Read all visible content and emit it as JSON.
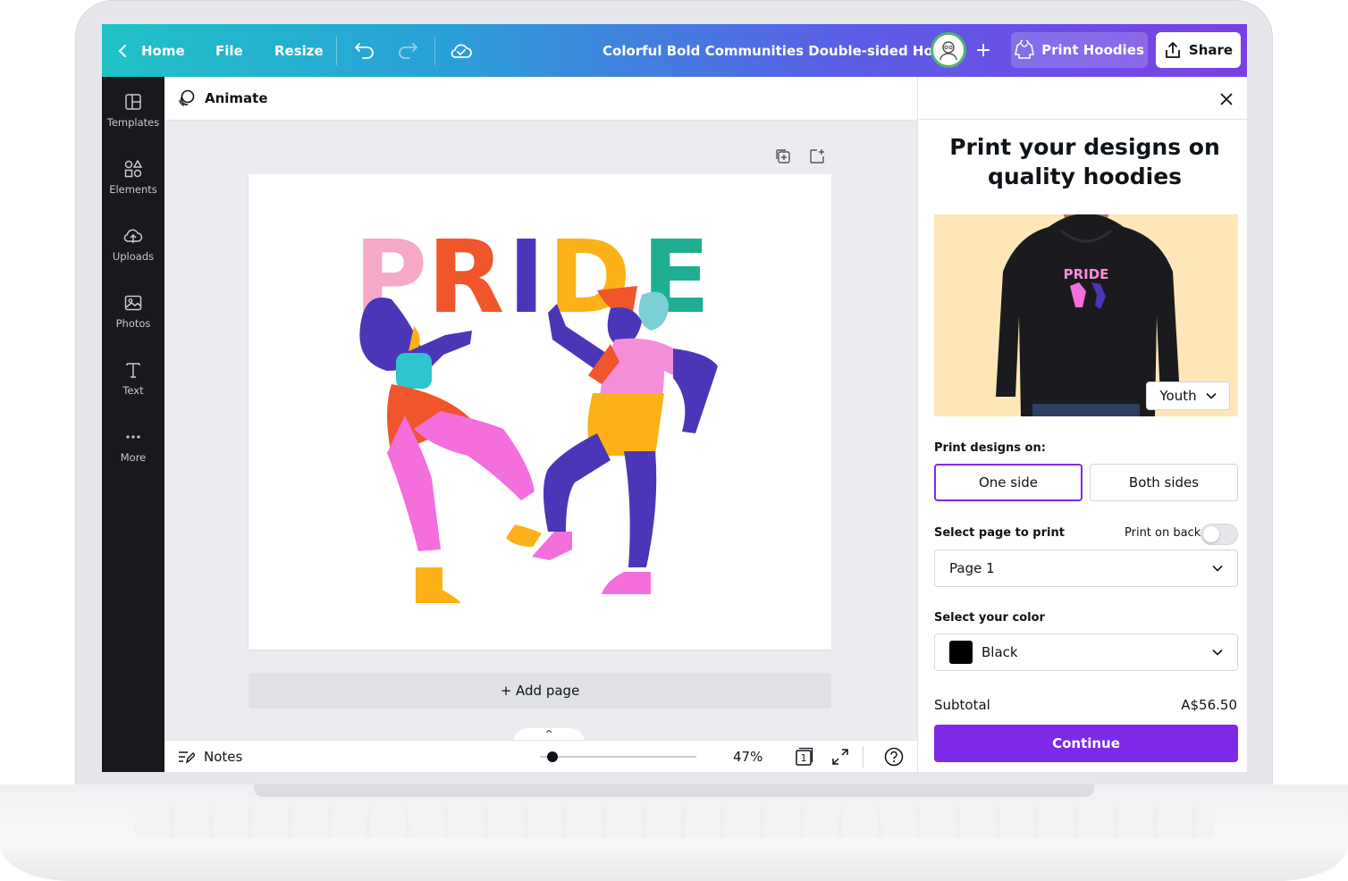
{
  "topbar": {
    "home": "Home",
    "file": "File",
    "resize": "Resize",
    "doc_title": "Colorful Bold Communities Double-sided Hoodie",
    "add_collab": "+",
    "print_button": "Print Hoodies",
    "share_button": "Share"
  },
  "sidebar": {
    "items": [
      {
        "label": "Templates",
        "icon": "templates-icon"
      },
      {
        "label": "Elements",
        "icon": "elements-icon"
      },
      {
        "label": "Uploads",
        "icon": "uploads-icon"
      },
      {
        "label": "Photos",
        "icon": "photos-icon"
      },
      {
        "label": "Text",
        "icon": "text-icon"
      },
      {
        "label": "More",
        "icon": "more-icon"
      }
    ]
  },
  "editor": {
    "animate": "Animate",
    "design_word": "PRIDE",
    "design_letter_colors": [
      "#f6a8c7",
      "#f0552b",
      "#4b36b8",
      "#fbb117",
      "#1fae91"
    ],
    "add_page": "+ Add page",
    "footer": {
      "notes": "Notes",
      "zoom": "47%",
      "page_count": "1",
      "expand_caret": "^"
    }
  },
  "panel": {
    "title": "Print your designs on quality hoodies",
    "product_print": "PRIDE",
    "size_select": "Youth",
    "print_on_label": "Print designs on:",
    "options": [
      "One side",
      "Both sides"
    ],
    "selected_option": "One side",
    "select_page_label": "Select page to print",
    "print_on_back": "Print on back",
    "page_value": "Page 1",
    "select_color_label": "Select your color",
    "color_value": "Black",
    "color_swatch": "#000000",
    "subtotal_label": "Subtotal",
    "subtotal_value": "A$56.50",
    "continue": "Continue"
  },
  "colors": {
    "accent": "#7d2ae8",
    "sidebar_bg": "#17191d",
    "selected_border": "#7d2ae8"
  }
}
